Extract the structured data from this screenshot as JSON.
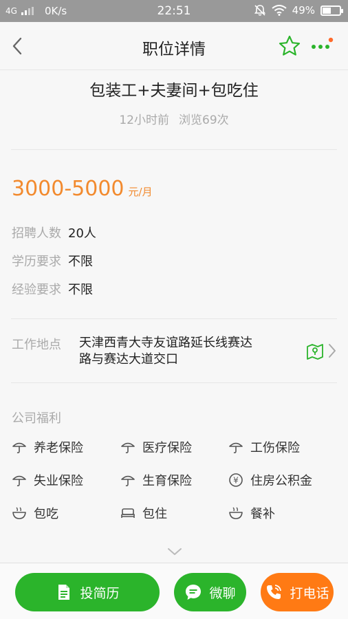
{
  "status_bar": {
    "network": "4G",
    "speed": "0K/s",
    "time": "22:51",
    "battery": "49%",
    "battery_level": 0.49
  },
  "header": {
    "title": "职位详情",
    "icons": [
      "back-arrow-icon",
      "star-icon",
      "more-icon"
    ],
    "accent_color": "#2bb42b",
    "notification_dot_color": "#ff6a2b"
  },
  "job": {
    "title": "包装工+夫妻间+包吃住",
    "posted": "12小时前",
    "views": "浏览69次",
    "salary": "3000-5000",
    "salary_unit": "元/月",
    "salary_color": "#f28a2e"
  },
  "requirements": [
    {
      "label": "招聘人数",
      "value": "20人"
    },
    {
      "label": "学历要求",
      "value": "不限"
    },
    {
      "label": "经验要求",
      "value": "不限"
    }
  ],
  "location": {
    "label": "工作地点",
    "address_line1": "天津西青大寺友谊路延长线赛达",
    "address_line2": "路与赛达大道交口",
    "icons": [
      "map-icon",
      "chevron-right-icon"
    ]
  },
  "benefits": {
    "title": "公司福利",
    "items": [
      {
        "label": "养老保险",
        "icon": "umbrella-icon"
      },
      {
        "label": "医疗保险",
        "icon": "umbrella-icon"
      },
      {
        "label": "工伤保险",
        "icon": "umbrella-icon"
      },
      {
        "label": "失业保险",
        "icon": "umbrella-icon"
      },
      {
        "label": "生育保险",
        "icon": "umbrella-icon"
      },
      {
        "label": "住房公积金",
        "icon": "yuan-icon"
      },
      {
        "label": "包吃",
        "icon": "bowl-icon"
      },
      {
        "label": "包住",
        "icon": "bed-icon"
      },
      {
        "label": "餐补",
        "icon": "bowl-icon"
      }
    ]
  },
  "actions": {
    "resume": {
      "label": "投简历",
      "icon": "document-icon",
      "color": "#2bb42b"
    },
    "chat": {
      "label": "微聊",
      "icon": "chat-icon",
      "color": "#2bb42b"
    },
    "call": {
      "label": "打电话",
      "icon": "phone-icon",
      "color": "#ff7a14"
    }
  }
}
